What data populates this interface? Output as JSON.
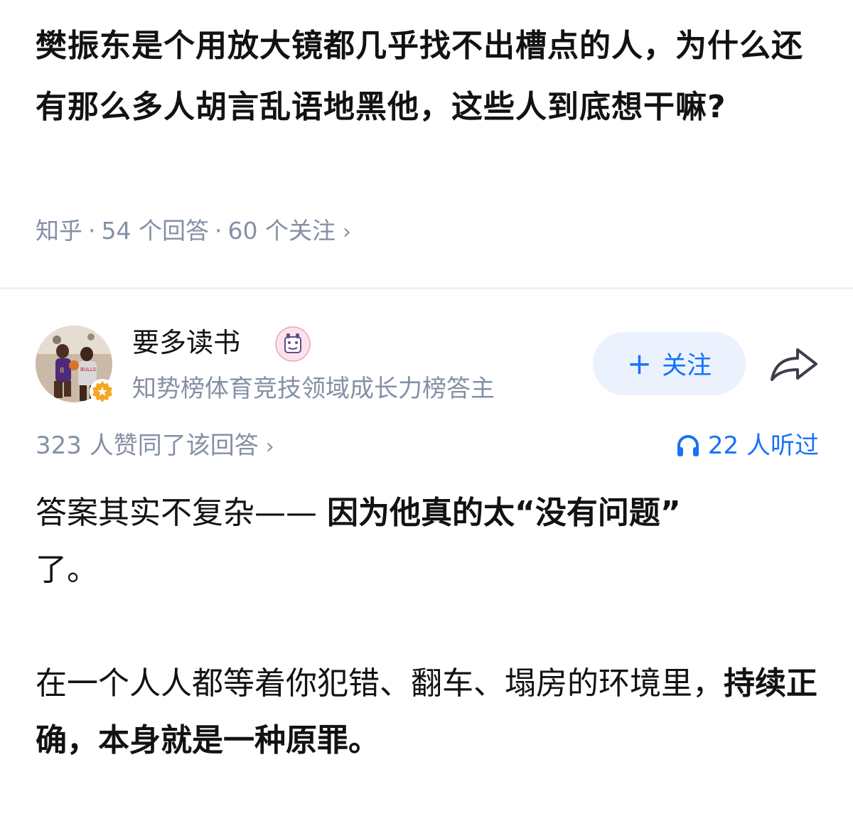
{
  "question": {
    "title": "樊振东是个用放大镜都几乎找不出槽点的人，为什么还有那么多人胡言乱语地黑他，这些人到底想干嘛?",
    "source": "知乎",
    "answer_count": "54 个回答",
    "follow_count": "60 个关注",
    "separator": "·",
    "arrow": "›"
  },
  "author": {
    "name": "要多读书",
    "description": "知势榜体育竞技领域成长力榜答主",
    "follow_label": "关注",
    "follow_plus": "+",
    "avatar_icon": "avatar-photo",
    "badge_icon": "orange-star-badge",
    "share_icon": "share-arrow-icon"
  },
  "stats": {
    "agree_text": "323 人赞同了该回答",
    "arrow": "›",
    "listen_text": "22 人听过"
  },
  "content": {
    "p1_normal": "答案其实不复杂—— ",
    "p1_bold": "因为他真的太“没有问题”",
    "p1_tail": "了。",
    "p2_normal": "在一个人人都等着你犯错、翻车、塌房的环境里，",
    "p2_bold": "持续正确，本身就是一种原罪。"
  },
  "colors": {
    "accent": "#1772f6",
    "follow_bg": "#ebf2fe",
    "meta_gray": "#8590a6",
    "badge": "#f5a623"
  }
}
